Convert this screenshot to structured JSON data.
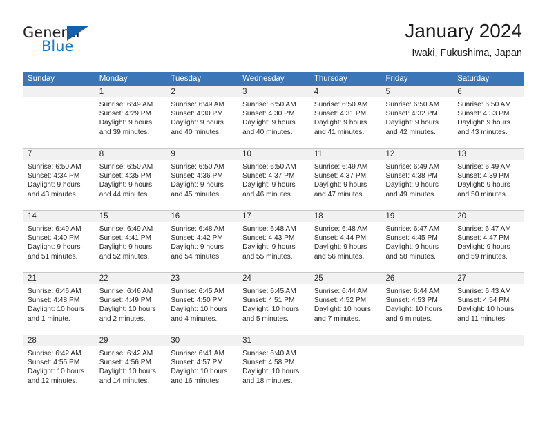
{
  "brand": {
    "name_part1": "General",
    "name_part2": "Blue",
    "logo_icon": "triangle-flag-icon",
    "accent_color": "#1560a8",
    "blue_text_color": "#1f7ac4"
  },
  "header": {
    "title": "January 2024",
    "subtitle": "Iwaki, Fukushima, Japan"
  },
  "calendar": {
    "header_bg_color": "#3a76b8",
    "daynum_band_color": "#f1f1f1",
    "weekdays": [
      "Sunday",
      "Monday",
      "Tuesday",
      "Wednesday",
      "Thursday",
      "Friday",
      "Saturday"
    ],
    "weeks": [
      [
        {
          "day": "",
          "sunrise": "",
          "sunset": "",
          "daylight_line1": "",
          "daylight_line2": "",
          "empty": true
        },
        {
          "day": "1",
          "sunrise": "Sunrise: 6:49 AM",
          "sunset": "Sunset: 4:29 PM",
          "daylight_line1": "Daylight: 9 hours",
          "daylight_line2": "and 39 minutes.",
          "empty": false
        },
        {
          "day": "2",
          "sunrise": "Sunrise: 6:49 AM",
          "sunset": "Sunset: 4:30 PM",
          "daylight_line1": "Daylight: 9 hours",
          "daylight_line2": "and 40 minutes.",
          "empty": false
        },
        {
          "day": "3",
          "sunrise": "Sunrise: 6:50 AM",
          "sunset": "Sunset: 4:30 PM",
          "daylight_line1": "Daylight: 9 hours",
          "daylight_line2": "and 40 minutes.",
          "empty": false
        },
        {
          "day": "4",
          "sunrise": "Sunrise: 6:50 AM",
          "sunset": "Sunset: 4:31 PM",
          "daylight_line1": "Daylight: 9 hours",
          "daylight_line2": "and 41 minutes.",
          "empty": false
        },
        {
          "day": "5",
          "sunrise": "Sunrise: 6:50 AM",
          "sunset": "Sunset: 4:32 PM",
          "daylight_line1": "Daylight: 9 hours",
          "daylight_line2": "and 42 minutes.",
          "empty": false
        },
        {
          "day": "6",
          "sunrise": "Sunrise: 6:50 AM",
          "sunset": "Sunset: 4:33 PM",
          "daylight_line1": "Daylight: 9 hours",
          "daylight_line2": "and 43 minutes.",
          "empty": false
        }
      ],
      [
        {
          "day": "7",
          "sunrise": "Sunrise: 6:50 AM",
          "sunset": "Sunset: 4:34 PM",
          "daylight_line1": "Daylight: 9 hours",
          "daylight_line2": "and 43 minutes.",
          "empty": false
        },
        {
          "day": "8",
          "sunrise": "Sunrise: 6:50 AM",
          "sunset": "Sunset: 4:35 PM",
          "daylight_line1": "Daylight: 9 hours",
          "daylight_line2": "and 44 minutes.",
          "empty": false
        },
        {
          "day": "9",
          "sunrise": "Sunrise: 6:50 AM",
          "sunset": "Sunset: 4:36 PM",
          "daylight_line1": "Daylight: 9 hours",
          "daylight_line2": "and 45 minutes.",
          "empty": false
        },
        {
          "day": "10",
          "sunrise": "Sunrise: 6:50 AM",
          "sunset": "Sunset: 4:37 PM",
          "daylight_line1": "Daylight: 9 hours",
          "daylight_line2": "and 46 minutes.",
          "empty": false
        },
        {
          "day": "11",
          "sunrise": "Sunrise: 6:49 AM",
          "sunset": "Sunset: 4:37 PM",
          "daylight_line1": "Daylight: 9 hours",
          "daylight_line2": "and 47 minutes.",
          "empty": false
        },
        {
          "day": "12",
          "sunrise": "Sunrise: 6:49 AM",
          "sunset": "Sunset: 4:38 PM",
          "daylight_line1": "Daylight: 9 hours",
          "daylight_line2": "and 49 minutes.",
          "empty": false
        },
        {
          "day": "13",
          "sunrise": "Sunrise: 6:49 AM",
          "sunset": "Sunset: 4:39 PM",
          "daylight_line1": "Daylight: 9 hours",
          "daylight_line2": "and 50 minutes.",
          "empty": false
        }
      ],
      [
        {
          "day": "14",
          "sunrise": "Sunrise: 6:49 AM",
          "sunset": "Sunset: 4:40 PM",
          "daylight_line1": "Daylight: 9 hours",
          "daylight_line2": "and 51 minutes.",
          "empty": false
        },
        {
          "day": "15",
          "sunrise": "Sunrise: 6:49 AM",
          "sunset": "Sunset: 4:41 PM",
          "daylight_line1": "Daylight: 9 hours",
          "daylight_line2": "and 52 minutes.",
          "empty": false
        },
        {
          "day": "16",
          "sunrise": "Sunrise: 6:48 AM",
          "sunset": "Sunset: 4:42 PM",
          "daylight_line1": "Daylight: 9 hours",
          "daylight_line2": "and 54 minutes.",
          "empty": false
        },
        {
          "day": "17",
          "sunrise": "Sunrise: 6:48 AM",
          "sunset": "Sunset: 4:43 PM",
          "daylight_line1": "Daylight: 9 hours",
          "daylight_line2": "and 55 minutes.",
          "empty": false
        },
        {
          "day": "18",
          "sunrise": "Sunrise: 6:48 AM",
          "sunset": "Sunset: 4:44 PM",
          "daylight_line1": "Daylight: 9 hours",
          "daylight_line2": "and 56 minutes.",
          "empty": false
        },
        {
          "day": "19",
          "sunrise": "Sunrise: 6:47 AM",
          "sunset": "Sunset: 4:45 PM",
          "daylight_line1": "Daylight: 9 hours",
          "daylight_line2": "and 58 minutes.",
          "empty": false
        },
        {
          "day": "20",
          "sunrise": "Sunrise: 6:47 AM",
          "sunset": "Sunset: 4:47 PM",
          "daylight_line1": "Daylight: 9 hours",
          "daylight_line2": "and 59 minutes.",
          "empty": false
        }
      ],
      [
        {
          "day": "21",
          "sunrise": "Sunrise: 6:46 AM",
          "sunset": "Sunset: 4:48 PM",
          "daylight_line1": "Daylight: 10 hours",
          "daylight_line2": "and 1 minute.",
          "empty": false
        },
        {
          "day": "22",
          "sunrise": "Sunrise: 6:46 AM",
          "sunset": "Sunset: 4:49 PM",
          "daylight_line1": "Daylight: 10 hours",
          "daylight_line2": "and 2 minutes.",
          "empty": false
        },
        {
          "day": "23",
          "sunrise": "Sunrise: 6:45 AM",
          "sunset": "Sunset: 4:50 PM",
          "daylight_line1": "Daylight: 10 hours",
          "daylight_line2": "and 4 minutes.",
          "empty": false
        },
        {
          "day": "24",
          "sunrise": "Sunrise: 6:45 AM",
          "sunset": "Sunset: 4:51 PM",
          "daylight_line1": "Daylight: 10 hours",
          "daylight_line2": "and 5 minutes.",
          "empty": false
        },
        {
          "day": "25",
          "sunrise": "Sunrise: 6:44 AM",
          "sunset": "Sunset: 4:52 PM",
          "daylight_line1": "Daylight: 10 hours",
          "daylight_line2": "and 7 minutes.",
          "empty": false
        },
        {
          "day": "26",
          "sunrise": "Sunrise: 6:44 AM",
          "sunset": "Sunset: 4:53 PM",
          "daylight_line1": "Daylight: 10 hours",
          "daylight_line2": "and 9 minutes.",
          "empty": false
        },
        {
          "day": "27",
          "sunrise": "Sunrise: 6:43 AM",
          "sunset": "Sunset: 4:54 PM",
          "daylight_line1": "Daylight: 10 hours",
          "daylight_line2": "and 11 minutes.",
          "empty": false
        }
      ],
      [
        {
          "day": "28",
          "sunrise": "Sunrise: 6:42 AM",
          "sunset": "Sunset: 4:55 PM",
          "daylight_line1": "Daylight: 10 hours",
          "daylight_line2": "and 12 minutes.",
          "empty": false
        },
        {
          "day": "29",
          "sunrise": "Sunrise: 6:42 AM",
          "sunset": "Sunset: 4:56 PM",
          "daylight_line1": "Daylight: 10 hours",
          "daylight_line2": "and 14 minutes.",
          "empty": false
        },
        {
          "day": "30",
          "sunrise": "Sunrise: 6:41 AM",
          "sunset": "Sunset: 4:57 PM",
          "daylight_line1": "Daylight: 10 hours",
          "daylight_line2": "and 16 minutes.",
          "empty": false
        },
        {
          "day": "31",
          "sunrise": "Sunrise: 6:40 AM",
          "sunset": "Sunset: 4:58 PM",
          "daylight_line1": "Daylight: 10 hours",
          "daylight_line2": "and 18 minutes.",
          "empty": false
        },
        {
          "day": "",
          "sunrise": "",
          "sunset": "",
          "daylight_line1": "",
          "daylight_line2": "",
          "empty": true
        },
        {
          "day": "",
          "sunrise": "",
          "sunset": "",
          "daylight_line1": "",
          "daylight_line2": "",
          "empty": true
        },
        {
          "day": "",
          "sunrise": "",
          "sunset": "",
          "daylight_line1": "",
          "daylight_line2": "",
          "empty": true
        }
      ]
    ]
  }
}
